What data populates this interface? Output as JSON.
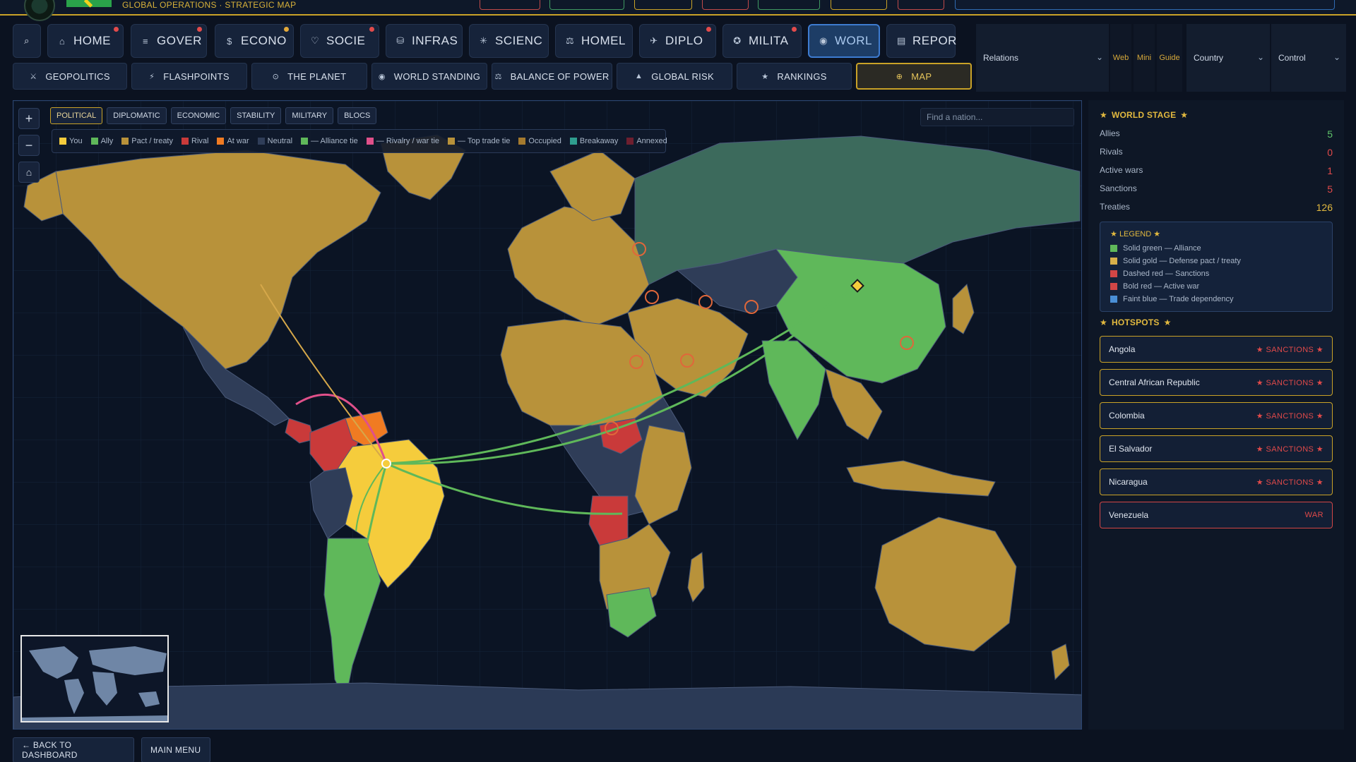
{
  "header": {
    "subtitle": "GLOBAL OPERATIONS · STRATEGIC MAP"
  },
  "nav": {
    "search_icon": "search-icon",
    "tabs": [
      {
        "label": "HOME",
        "icon": "⌂",
        "badge": "red"
      },
      {
        "label": "GOVER",
        "icon": "≡",
        "badge": "red"
      },
      {
        "label": "ECONO",
        "icon": "$",
        "badge": "amber"
      },
      {
        "label": "SOCIE",
        "icon": "♡",
        "badge": "red"
      },
      {
        "label": "INFRAS",
        "icon": "⛁",
        "badge": ""
      },
      {
        "label": "SCIENC",
        "icon": "✳",
        "badge": ""
      },
      {
        "label": "HOMEL",
        "icon": "⚖",
        "badge": ""
      },
      {
        "label": "DIPLO",
        "icon": "✈",
        "badge": "red"
      },
      {
        "label": "MILITA",
        "icon": "✪",
        "badge": "red"
      },
      {
        "label": "WORL",
        "icon": "◉",
        "badge": "",
        "active": true
      },
      {
        "label": "REPOR",
        "icon": "▤",
        "badge": ""
      }
    ]
  },
  "selectors": {
    "relations": "Relations",
    "web": "Web",
    "mini": "Mini",
    "guide": "Guide",
    "country": "Country",
    "control": "Control"
  },
  "subnav": [
    {
      "label": "GEOPOLITICS",
      "icon": "⚔"
    },
    {
      "label": "FLASHPOINTS",
      "icon": "⚡"
    },
    {
      "label": "THE PLANET",
      "icon": "⊙"
    },
    {
      "label": "WORLD STANDING",
      "icon": "◉"
    },
    {
      "label": "BALANCE OF POWER",
      "icon": "⚖"
    },
    {
      "label": "GLOBAL RISK",
      "icon": "▲"
    },
    {
      "label": "RANKINGS",
      "icon": "★"
    },
    {
      "label": "MAP",
      "icon": "⊕",
      "active": true
    }
  ],
  "map": {
    "zoom_in": "+",
    "zoom_out": "−",
    "home": "⌂",
    "modes": [
      "POLITICAL",
      "DIPLOMATIC",
      "ECONOMIC",
      "STABILITY",
      "MILITARY",
      "BLOCS"
    ],
    "active_mode": "POLITICAL",
    "search_placeholder": "Find a nation...",
    "legend": [
      {
        "label": "You",
        "color": "#f5cc3c"
      },
      {
        "label": "Ally",
        "color": "#5fb85a"
      },
      {
        "label": "Pact / treaty",
        "color": "#b8923a"
      },
      {
        "label": "Rival",
        "color": "#c93a3a"
      },
      {
        "label": "At war",
        "color": "#f07b22"
      },
      {
        "label": "Neutral",
        "color": "#2f3d58"
      },
      {
        "label": "— Alliance tie",
        "color": "#5fb85a"
      },
      {
        "label": "— Rivalry / war tie",
        "color": "#e0508a"
      },
      {
        "label": "— Top trade tie",
        "color": "#b8923a"
      },
      {
        "label": "Occupied",
        "color": "#a47a2e"
      },
      {
        "label": "Breakaway",
        "color": "#2f9e8f"
      },
      {
        "label": "Annexed",
        "color": "#6e1f2f"
      }
    ]
  },
  "world_stage": {
    "title": "WORLD STAGE",
    "stats": [
      {
        "label": "Allies",
        "value": "5",
        "color": "#5fc36a"
      },
      {
        "label": "Rivals",
        "value": "0",
        "color": "#e14a4a"
      },
      {
        "label": "Active wars",
        "value": "1",
        "color": "#e14a4a"
      },
      {
        "label": "Sanctions",
        "value": "5",
        "color": "#e14a4a"
      },
      {
        "label": "Treaties",
        "value": "126",
        "color": "#e2b93f"
      }
    ]
  },
  "legend_panel": {
    "title": "LEGEND",
    "items": [
      {
        "label": "Solid green — Alliance",
        "color": "#5fb85a"
      },
      {
        "label": "Solid gold — Defense pact / treaty",
        "color": "#d8b04a"
      },
      {
        "label": "Dashed red — Sanctions",
        "color": "#d24646"
      },
      {
        "label": "Bold red — Active war",
        "color": "#d24646"
      },
      {
        "label": "Faint blue — Trade dependency",
        "color": "#4a8fd6"
      }
    ]
  },
  "hotspots": {
    "title": "HOTSPOTS",
    "items": [
      {
        "country": "Angola",
        "status": "SANCTIONS"
      },
      {
        "country": "Central African Republic",
        "status": "SANCTIONS"
      },
      {
        "country": "Colombia",
        "status": "SANCTIONS"
      },
      {
        "country": "El Salvador",
        "status": "SANCTIONS"
      },
      {
        "country": "Nicaragua",
        "status": "SANCTIONS"
      },
      {
        "country": "Venezuela",
        "status": "WAR"
      }
    ]
  },
  "footer": {
    "back": "← BACK TO DASHBOARD",
    "menu": "MAIN MENU"
  }
}
